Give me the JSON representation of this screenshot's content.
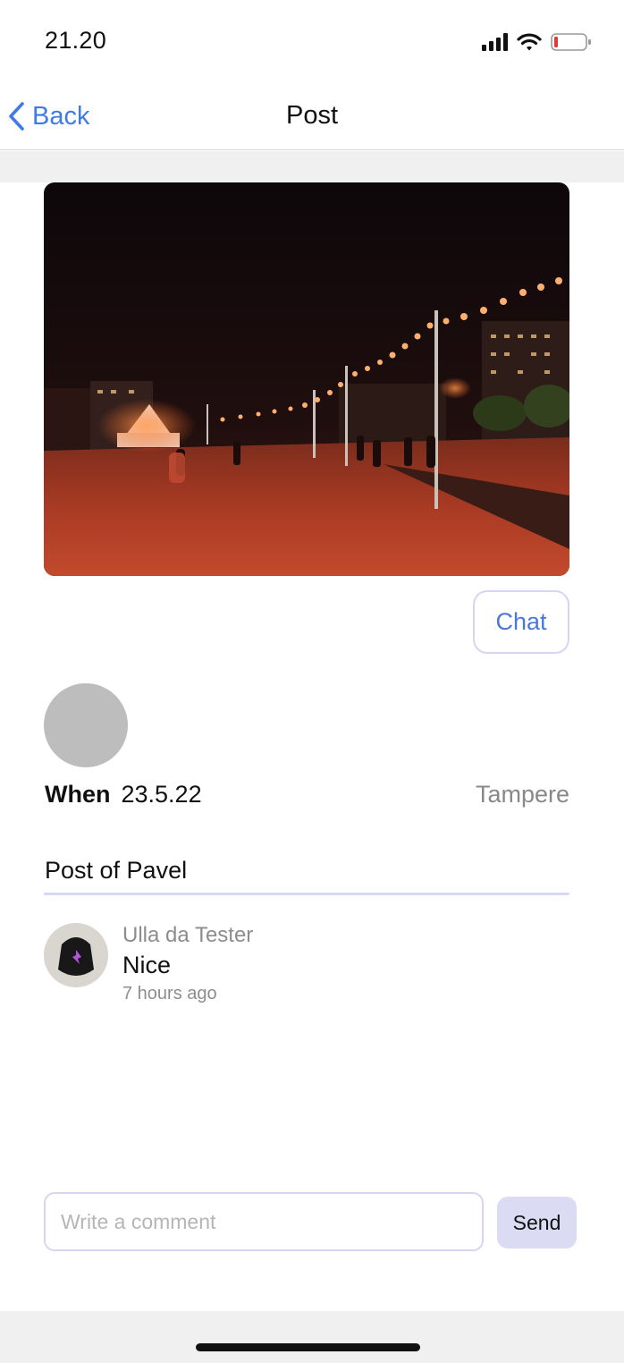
{
  "status_bar": {
    "time": "21.20",
    "icons": [
      "signal-icon",
      "wifi-icon",
      "battery-low-icon"
    ],
    "battery_color": "#e53935"
  },
  "nav": {
    "back_label": "Back",
    "title": "Post",
    "accent_color": "#3f7be8"
  },
  "post": {
    "image_description_icon": "night-festival-photo",
    "chat_label": "Chat",
    "when_label": "When",
    "date": "23.5.22",
    "location": "Tampere",
    "title": "Post of Pavel"
  },
  "comments": [
    {
      "author": "Ulla da Tester",
      "text": "Nice",
      "time": "7 hours ago"
    }
  ],
  "composer": {
    "placeholder": "Write a comment",
    "value": "",
    "send_label": "Send"
  }
}
